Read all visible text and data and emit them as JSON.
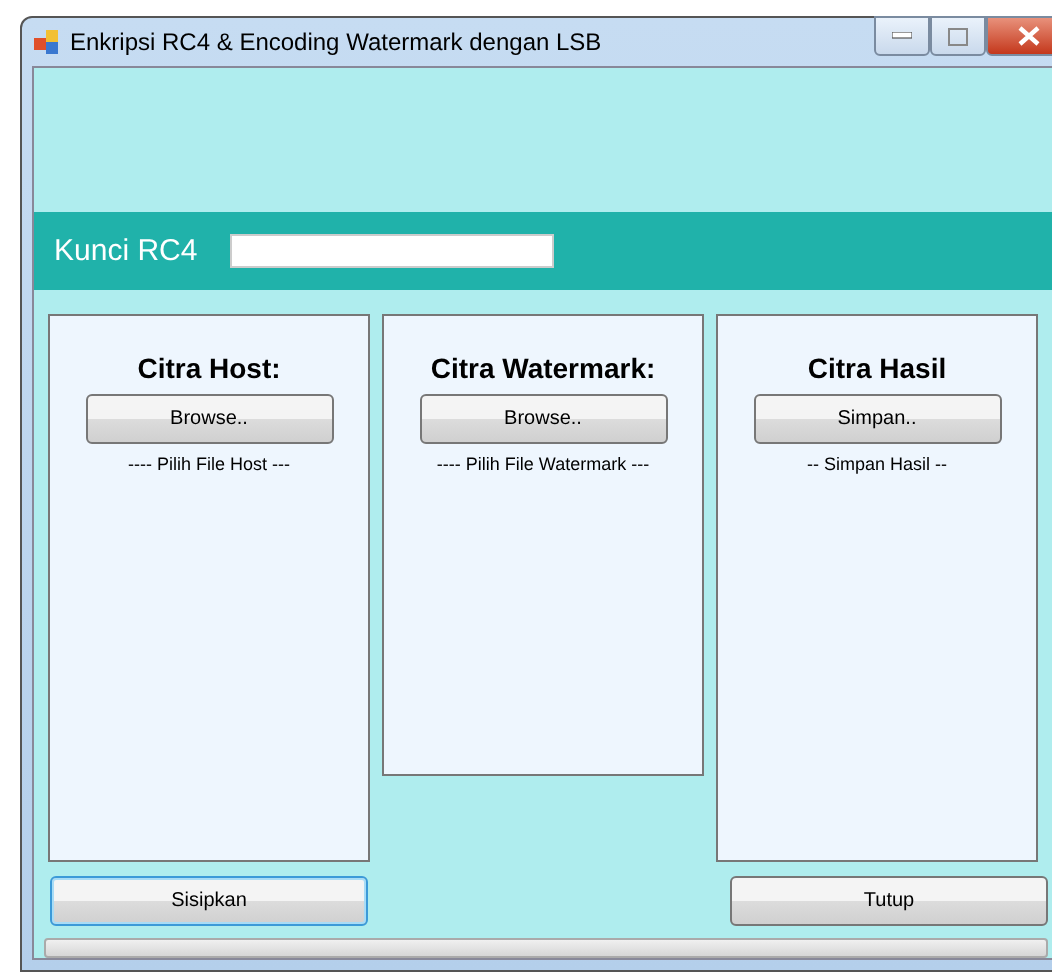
{
  "window": {
    "title": "Enkripsi RC4 & Encoding Watermark dengan LSB"
  },
  "key_bar": {
    "label": "Kunci RC4"
  },
  "panels": [
    {
      "title": "Citra Host:",
      "button": "Browse..",
      "caption": "---- Pilih File Host ---",
      "tall": true
    },
    {
      "title": "Citra Watermark:",
      "button": "Browse..",
      "caption": "---- Pilih File Watermark ---",
      "tall": false
    },
    {
      "title": "Citra Hasil",
      "button": "Simpan..",
      "caption": "-- Simpan Hasil --",
      "tall": true
    }
  ],
  "bottom_buttons": [
    {
      "label": "Sisipkan",
      "focused": true
    },
    {
      "label": "Tutup",
      "focused": false
    }
  ],
  "progress": {
    "level": 0
  }
}
